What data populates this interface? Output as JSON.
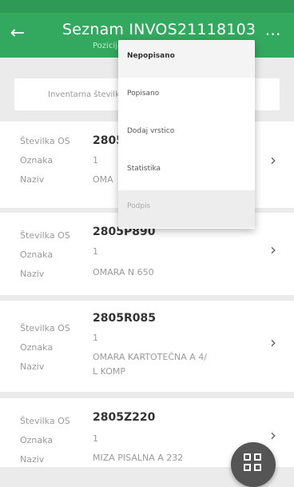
{
  "appbar": {
    "title": "Seznam INVOS21118103",
    "subtitle": "Pozicija",
    "back_icon": "arrow-left-icon",
    "more_icon": "more-horizontal-icon"
  },
  "search": {
    "placeholder": "Inventarna številka"
  },
  "labels": {
    "stevilka": "Številka OS",
    "oznaka": "Oznaka",
    "naziv": "Naziv"
  },
  "items": [
    {
      "code": "2805",
      "oznaka": "1",
      "naziv": "OMA"
    },
    {
      "code": "2805P890",
      "oznaka": "1",
      "naziv": "OMARA N 650"
    },
    {
      "code": "2805R085",
      "oznaka": "1",
      "naziv_line1": "OMARA KARTOTEČNA A 4/",
      "naziv_line2": "L KOMP"
    },
    {
      "code": "2805Z220",
      "oznaka": "1",
      "naziv": "MIZA PISALNA A 232"
    }
  ],
  "menu": {
    "items": [
      {
        "label": "Nepopisano",
        "state": "active"
      },
      {
        "label": "Popisano",
        "state": "normal"
      },
      {
        "label": "Dodaj vrstico",
        "state": "normal"
      },
      {
        "label": "Statistika",
        "state": "normal"
      },
      {
        "label": "Podpis",
        "state": "disabled"
      }
    ]
  },
  "fab": {
    "icon": "grid-icon"
  },
  "colors": {
    "appbar": "#32a95e",
    "statusbar": "#2f9a55",
    "background": "#ebebeb",
    "fab": "#555555"
  }
}
